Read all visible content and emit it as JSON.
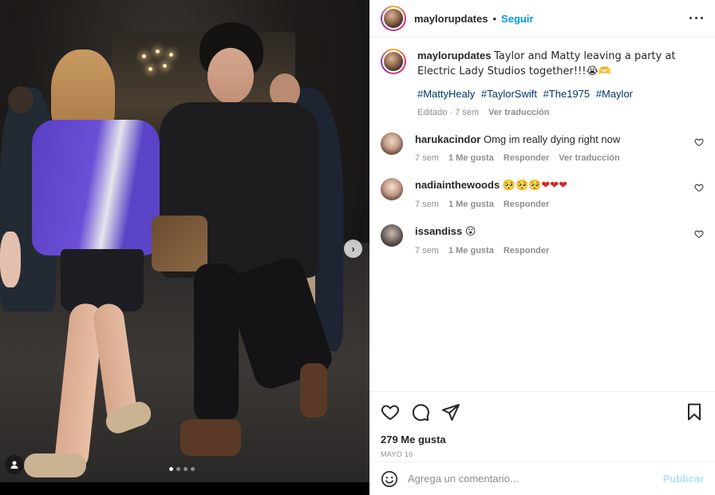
{
  "post": {
    "username": "maylorupdates",
    "separator": "•",
    "follow_label": "Seguir",
    "more_label": "···"
  },
  "caption": {
    "username": "maylorupdates",
    "text": "Taylor and Matty leaving a party at Electric Lady Studios together!!!😭🫶",
    "hashtags": [
      "#MattyHealy",
      "#TaylorSwift",
      "#The1975",
      "#Maylor"
    ],
    "edited": "Editado · 7 sem",
    "translate": "Ver traducción"
  },
  "comments": [
    {
      "username": "harukacindor",
      "text": "Omg im really dying right now",
      "time": "7 sem",
      "likes": "1 Me gusta",
      "reply": "Responder",
      "translate": "Ver traducción"
    },
    {
      "username": "nadiainthewoods",
      "text": "🥺🥺🥺❤❤❤",
      "time": "7 sem",
      "likes": "1 Me gusta",
      "reply": "Responder"
    },
    {
      "username": "issandiss",
      "text": "😮",
      "time": "7 sem",
      "likes": "1 Me gusta",
      "reply": "Responder"
    }
  ],
  "stats": {
    "likes": "279 Me gusta",
    "date": "MAYO 16"
  },
  "composer": {
    "placeholder": "Agrega un comentario...",
    "publish_label": "Publicar"
  },
  "carousel": {
    "next_label": "›",
    "slide_count": 4,
    "active_slide": 1
  },
  "colors": {
    "link_blue": "#0095f6",
    "hashtag_blue": "#00376b",
    "muted_gray": "#8e8e8e",
    "publish_disabled": "#b2dffc"
  }
}
